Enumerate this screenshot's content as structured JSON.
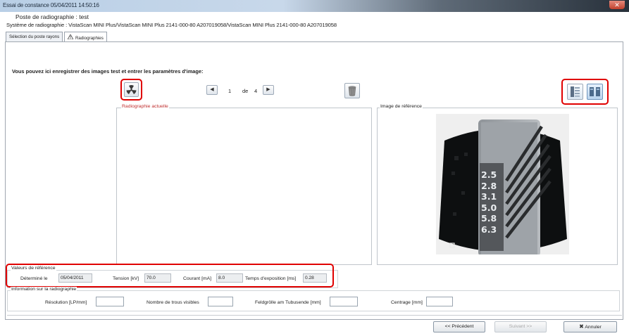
{
  "window": {
    "title": "Essai de constance 05/04/2011 14:50:16",
    "close_glyph": "✕"
  },
  "header": {
    "station_line": "Poste de radiographie :  test",
    "system_line": "Système de radiographie : VistaScan MINI Plus/VistaScan MINI Plus 2141-000-80 A207019058/VistaScan MINI Plus 2141-000-80 A207019058"
  },
  "tabs": [
    {
      "label": "Sélection du poste rayons",
      "active": false
    },
    {
      "label": "Radiographies",
      "active": true,
      "icon": "warning-icon"
    }
  ],
  "instruction": "Vous pouvez ici enregistrer des images test et entrer les paramètres d'image:",
  "toolbar": {
    "radiation_icon": "radiation-icon",
    "pager": {
      "current": "1",
      "separator": "de",
      "total": "4",
      "prev_glyph": "◀",
      "next_glyph": "▶"
    },
    "delete_icon": "trash-icon",
    "view_icons": [
      "layout-list-icon",
      "layout-split-icon"
    ]
  },
  "panels": {
    "current_label": "Radiographie actuelle",
    "reference_label": "Image de référence",
    "reference_image_labels": [
      "2.5",
      "2.8",
      "3.1",
      "5.0",
      "5.8",
      "6.3"
    ]
  },
  "reference_values": {
    "group_label": "Valeurs de référence",
    "determined_label": "Déterminé le",
    "determined_value": "05/04/2011",
    "voltage_label": "Tension [kV]",
    "voltage_value": "70.0",
    "current_label": "Courant [mA]",
    "current_value": "8.0",
    "exposure_label": "Temps d'exposition [ms]",
    "exposure_value": "0.28"
  },
  "results": {
    "group_label": "Information sur la radiographie",
    "resolution_label": "Résolution [LP/mm]",
    "holes_label": "Nombre de trous visibles",
    "feldgroesse_label": "Feldgrölle am Tubusende [mm]",
    "centering_label": "Centrage [mm]"
  },
  "footer": {
    "previous": "<< Précédent",
    "next": "Suivant >>",
    "cancel": "Annuler",
    "cancel_icon": "✖"
  },
  "colors": {
    "highlight": "#e00000",
    "panel_label": "#c03030"
  }
}
